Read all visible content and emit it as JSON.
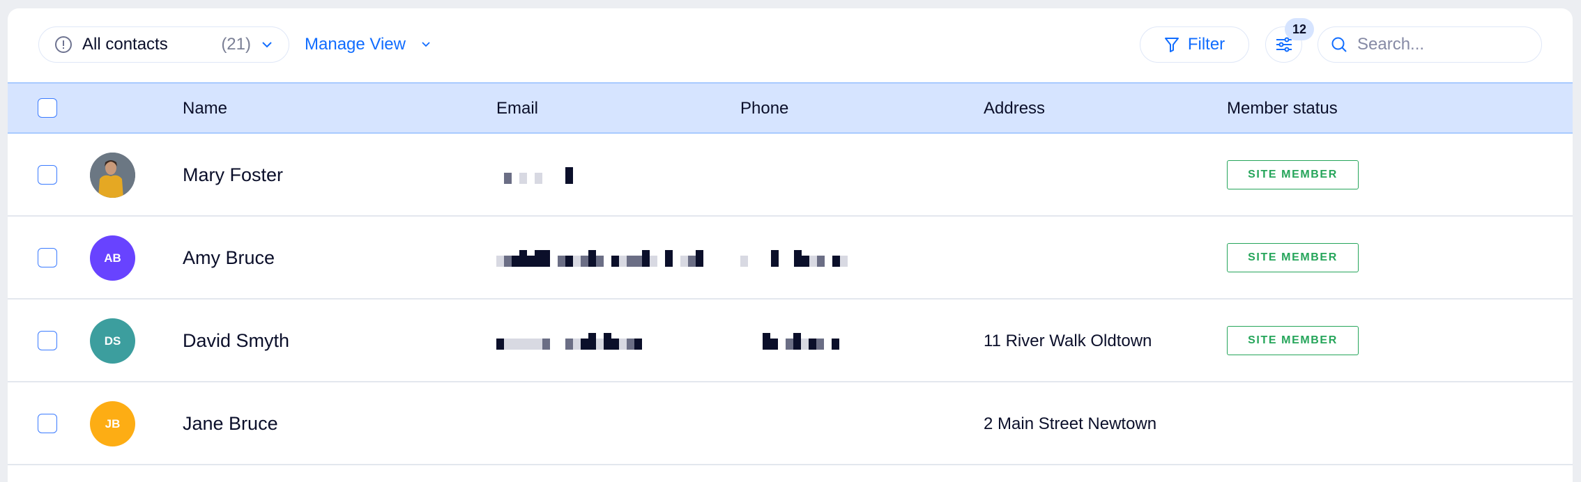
{
  "toolbar": {
    "view_label": "All contacts",
    "view_count": "(21)",
    "manage_view": "Manage View",
    "filter": "Filter",
    "settings_badge": "12",
    "search_placeholder": "Search..."
  },
  "table": {
    "columns": [
      "Name",
      "Email",
      "Phone",
      "Address",
      "Member status"
    ],
    "rows": [
      {
        "name": "Mary Foster",
        "initials": "",
        "avatar_type": "photo",
        "avatar_color": "#6b7783",
        "address": "",
        "status": "SITE MEMBER"
      },
      {
        "name": "Amy Bruce",
        "initials": "AB",
        "avatar_type": "initials",
        "avatar_color": "#6843ff",
        "address": "",
        "status": "SITE MEMBER"
      },
      {
        "name": "David Smyth",
        "initials": "DS",
        "avatar_type": "initials",
        "avatar_color": "#3c9e9e",
        "address": "11 River Walk Oldtown",
        "status": "SITE MEMBER"
      },
      {
        "name": "Jane Bruce",
        "initials": "JB",
        "avatar_type": "initials",
        "avatar_color": "#fdad14",
        "address": "2 Main Street Newtown",
        "status": ""
      }
    ]
  },
  "colors": {
    "accent": "#116dff",
    "header_bg": "#d6e4ff",
    "member_green": "#25a55a"
  }
}
